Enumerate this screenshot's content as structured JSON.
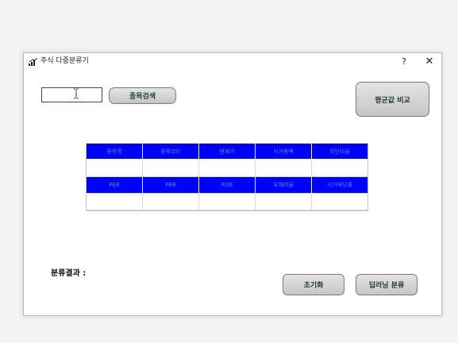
{
  "window": {
    "title": "주식 다중분류기",
    "help_label": "?",
    "close_label": "✕"
  },
  "search": {
    "value": "",
    "button_label": "종목검색"
  },
  "compare_button_label": "평균값 비교",
  "table": {
    "header_row_1": [
      "종목명",
      "종목코드",
      "현재가",
      "시가총액",
      "외인비율"
    ],
    "header_row_2": [
      "PER",
      "PBR",
      "ROE",
      "부채비율",
      "시가배당률"
    ],
    "values_row_1": [
      "",
      "",
      "",
      "",
      ""
    ],
    "values_row_2": [
      "",
      "",
      "",
      "",
      ""
    ]
  },
  "result_label": "분류결과 :",
  "reset_button_label": "초기화",
  "classify_button_label": "딥러닝 분류",
  "colors": {
    "header_bg": "#0000ff",
    "header_text": "#5a86d8"
  }
}
